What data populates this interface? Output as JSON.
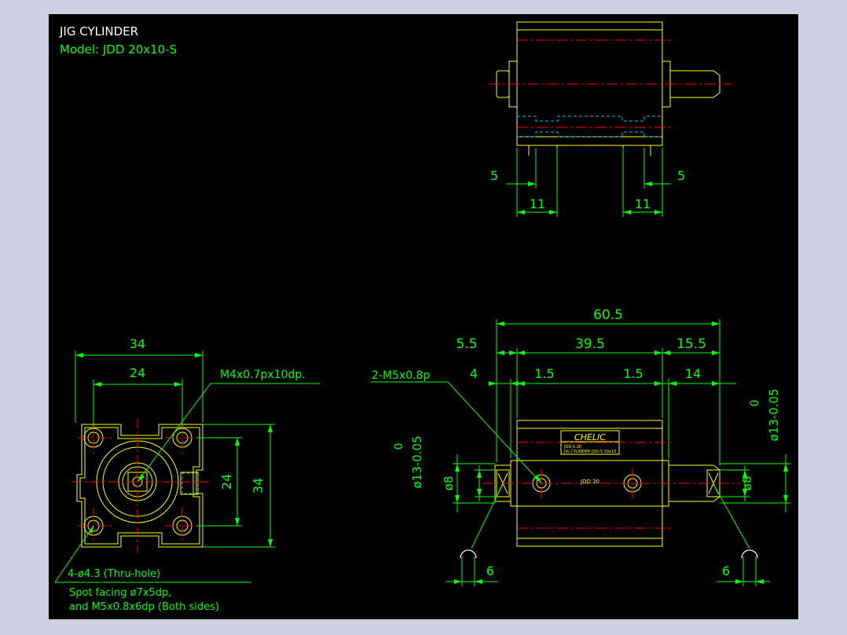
{
  "title_block": {
    "title": "JIG CYLINDER",
    "model": "Model: JDD 20x10-S"
  },
  "top_view": {
    "dim_left_small": "5",
    "dim_right_small": "5",
    "dim_left_wide": "11",
    "dim_right_wide": "11"
  },
  "end_view": {
    "dim_top_outer": "34",
    "dim_top_inner": "24",
    "dim_side_inner": "24",
    "dim_side_outer": "34",
    "thread_note": "M4x0.7px10dp.",
    "hole_note": "4-ø4.3 (Thru-hole)",
    "spot_note_1": "Spot facing ø7x5dp,",
    "spot_note_2": "and M5x0.8x6dp (Both sides)"
  },
  "side_view": {
    "dim_overall": "60.5",
    "dim_left": "5.5",
    "dim_body": "39.5",
    "dim_right": "15.5",
    "dim_4": "4",
    "dim_1_5_left": "1.5",
    "dim_1_5_right": "1.5",
    "dim_14": "14",
    "port_note": "2-M5x0.8p",
    "dia_left_zero": "0",
    "dia_left_main": "ø13-0.05",
    "dia_left_8": "ø8",
    "dia_right_zero": "0",
    "dia_right_main": "ø13-0.05",
    "dia_right_8": "ø8",
    "dim_6_left": "6",
    "dim_6_right": "6",
    "label_brand": "CHELIC",
    "label_line_1": "JDD-S 20",
    "label_line_2": "JIG CYLINDER JDD-S 20x10",
    "body_text": "JDD 20"
  },
  "colors": {
    "background": "#000000",
    "outline": "#ffff00",
    "dimension": "#00ff00",
    "centerline": "#ff0000",
    "hidden": "#00c8ff",
    "title": "#ffffff"
  }
}
